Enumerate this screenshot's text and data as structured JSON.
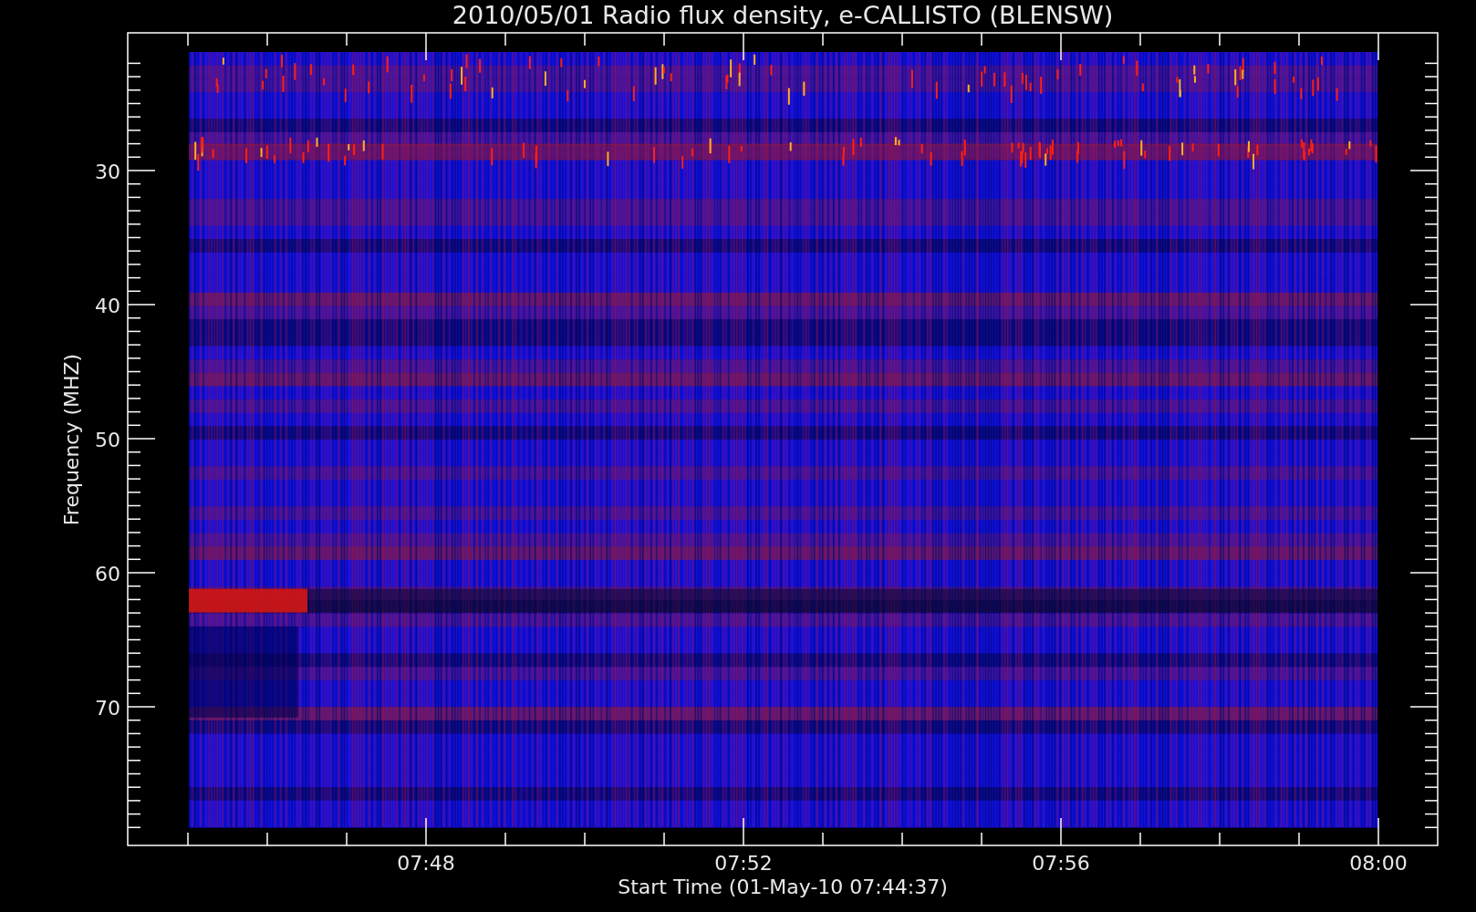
{
  "title": "2010/05/01  Radio flux density, e-CALLISTO (BLENSW)",
  "y_axis": {
    "label": "Frequency (MHZ)",
    "ticks": [
      "30",
      "40",
      "50",
      "60",
      "70"
    ]
  },
  "x_axis": {
    "label": "Start Time (01-May-10 07:44:37)",
    "ticks": [
      "07:48",
      "07:52",
      "07:56",
      "08:00"
    ]
  }
}
